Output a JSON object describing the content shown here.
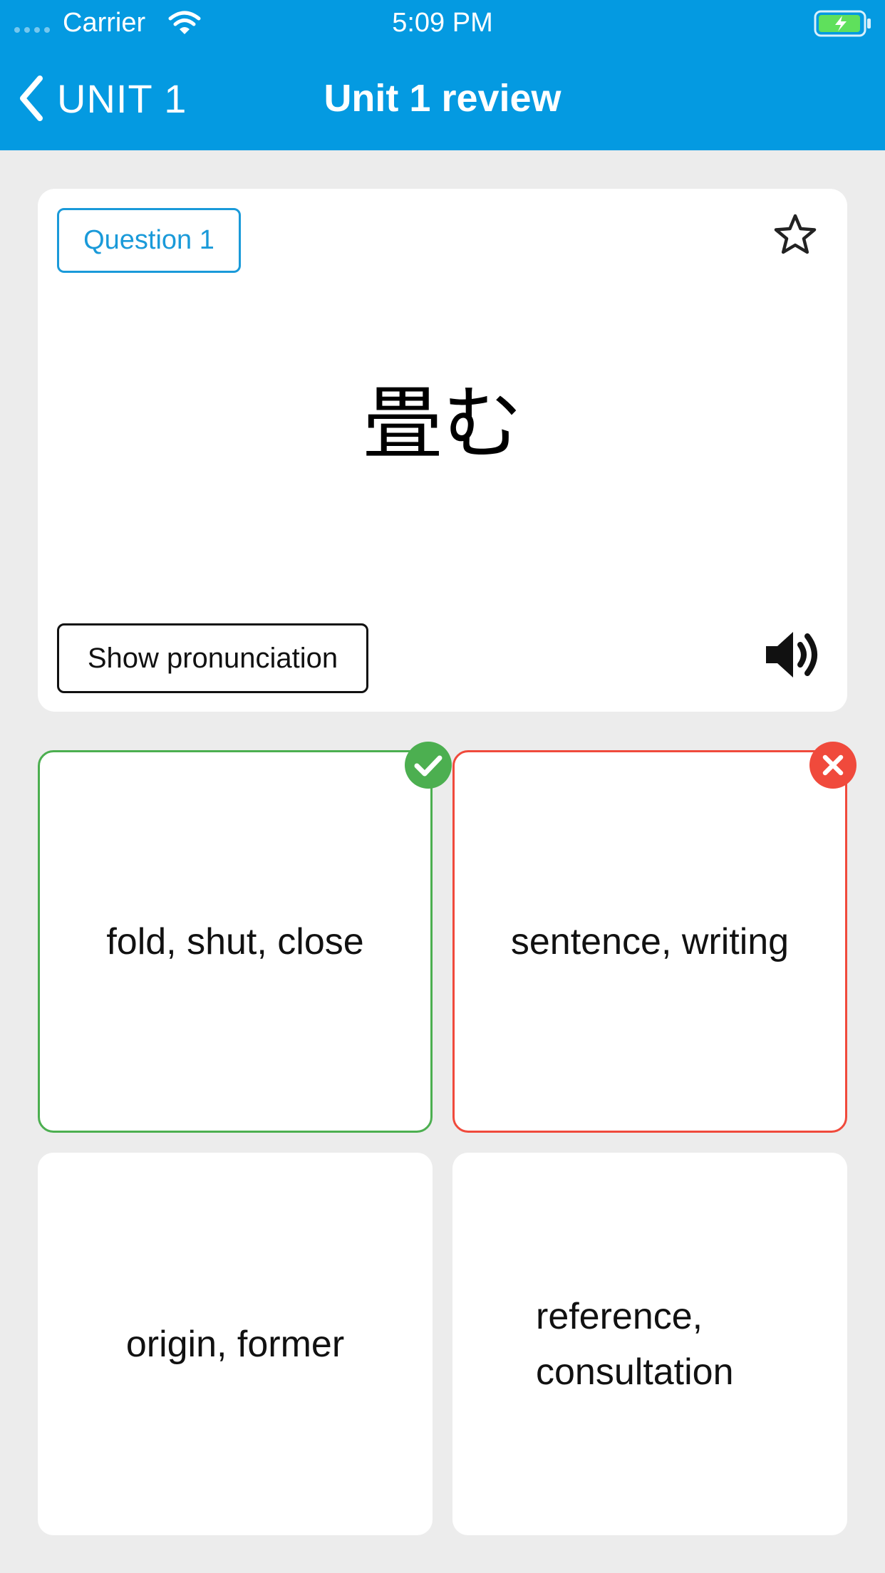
{
  "status_bar": {
    "carrier": "Carrier",
    "time": "5:09 PM",
    "battery_icon": "battery-charging-icon",
    "wifi_icon": "wifi-icon"
  },
  "nav": {
    "back_label": "UNIT 1",
    "title": "Unit 1 review",
    "back_icon": "chevron-left-icon"
  },
  "question": {
    "badge": "Question 1",
    "prompt": "畳む",
    "show_pronunciation_label": "Show pronunciation",
    "star_icon": "star-outline-icon",
    "speaker_icon": "speaker-icon"
  },
  "answers": [
    {
      "text": "fold, shut, close",
      "state": "correct"
    },
    {
      "text": "sentence, writing",
      "state": "wrong"
    },
    {
      "text": "origin, former",
      "state": "none"
    },
    {
      "text": "reference, consultation",
      "state": "none"
    }
  ],
  "colors": {
    "header": "#049ae1",
    "accent": "#1a9ad9",
    "correct": "#4caf50",
    "wrong": "#f04a3c",
    "background": "#ececec"
  }
}
